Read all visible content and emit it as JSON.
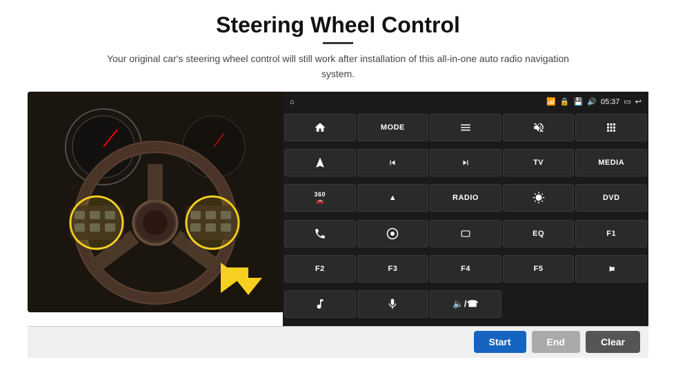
{
  "page": {
    "title": "Steering Wheel Control",
    "subtitle": "Your original car's steering wheel control will still work after installation of this all-in-one auto radio navigation system."
  },
  "status_bar": {
    "time": "05:37",
    "icons": [
      "wifi",
      "lock",
      "sd",
      "bluetooth",
      "display",
      "back"
    ]
  },
  "control_buttons": [
    {
      "id": "btn-home",
      "label": "⌂",
      "icon": "home-icon"
    },
    {
      "id": "btn-mode",
      "label": "MODE",
      "icon": "mode-icon"
    },
    {
      "id": "btn-list",
      "label": "☰",
      "icon": "list-icon"
    },
    {
      "id": "btn-mute",
      "label": "🔇",
      "icon": "mute-icon"
    },
    {
      "id": "btn-apps",
      "label": "⠿",
      "icon": "apps-icon"
    },
    {
      "id": "btn-send",
      "label": "↗",
      "icon": "send-icon"
    },
    {
      "id": "btn-prev",
      "label": "⏮",
      "icon": "prev-icon"
    },
    {
      "id": "btn-next",
      "label": "⏭",
      "icon": "next-icon"
    },
    {
      "id": "btn-tv",
      "label": "TV",
      "icon": "tv-icon"
    },
    {
      "id": "btn-media",
      "label": "MEDIA",
      "icon": "media-icon"
    },
    {
      "id": "btn-360",
      "label": "360",
      "icon": "360-icon"
    },
    {
      "id": "btn-eject",
      "label": "▲",
      "icon": "eject-icon"
    },
    {
      "id": "btn-radio",
      "label": "RADIO",
      "icon": "radio-icon"
    },
    {
      "id": "btn-bright",
      "label": "☀",
      "icon": "brightness-icon"
    },
    {
      "id": "btn-dvd",
      "label": "DVD",
      "icon": "dvd-icon"
    },
    {
      "id": "btn-phone",
      "label": "📞",
      "icon": "phone-icon"
    },
    {
      "id": "btn-navi",
      "label": "◎",
      "icon": "navi-icon"
    },
    {
      "id": "btn-rect",
      "label": "▭",
      "icon": "display-icon"
    },
    {
      "id": "btn-eq",
      "label": "EQ",
      "icon": "eq-icon"
    },
    {
      "id": "btn-f1",
      "label": "F1",
      "icon": "f1-icon"
    },
    {
      "id": "btn-f2",
      "label": "F2",
      "icon": "f2-icon"
    },
    {
      "id": "btn-f3",
      "label": "F3",
      "icon": "f3-icon"
    },
    {
      "id": "btn-f4",
      "label": "F4",
      "icon": "f4-icon"
    },
    {
      "id": "btn-f5",
      "label": "F5",
      "icon": "f5-icon"
    },
    {
      "id": "btn-playpause",
      "label": "▶⏸",
      "icon": "playpause-icon"
    },
    {
      "id": "btn-music",
      "label": "♪",
      "icon": "music-icon"
    },
    {
      "id": "btn-mic",
      "label": "🎤",
      "icon": "mic-icon"
    },
    {
      "id": "btn-volphone",
      "label": "🔈/☎",
      "icon": "volphone-icon"
    }
  ],
  "bottom_bar": {
    "start_label": "Start",
    "end_label": "End",
    "clear_label": "Clear"
  }
}
